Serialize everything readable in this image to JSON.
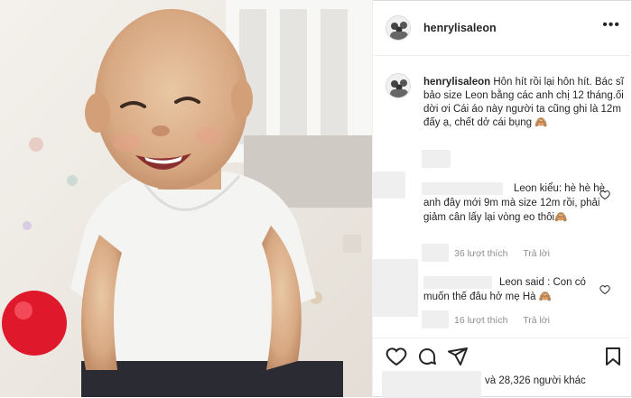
{
  "post": {
    "username": "henrylisaleon",
    "caption_text": "Hôn hít rồi lại hôn hít. Bác sĩ bảo size Leon bằng các anh chị 12 tháng.ối dời ơi Cái áo này người ta cũng ghi là 12m đấy ạ, chết dở cái bụng 🙈"
  },
  "comments": [
    {
      "text": "Leon kiểu: hè hè hè anh đây mới 9m mà size 12m rồi, phải giảm cân lấy lại vòng eo thôi🙈",
      "likes": "36 lượt thích",
      "reply": "Trả lời"
    },
    {
      "text": "Leon said : Con có muốn thế đâu hở mẹ Hà 🙈",
      "likes": "16 lượt thích",
      "reply": "Trả lời"
    }
  ],
  "footer": {
    "likes_text": "và 28,326 người khác"
  },
  "icons": [
    "more-options-icon",
    "heart-icon",
    "comment-icon",
    "share-icon",
    "bookmark-icon"
  ]
}
